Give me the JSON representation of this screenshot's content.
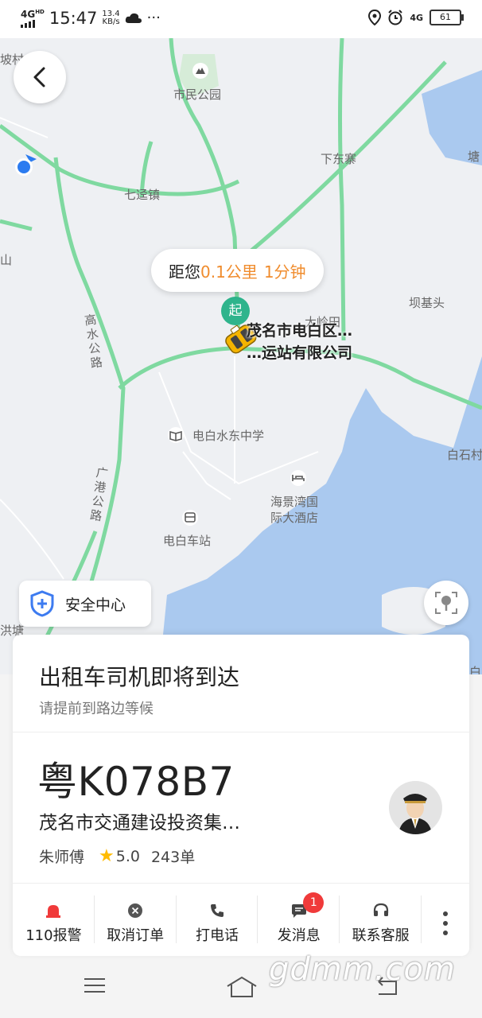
{
  "status_bar": {
    "network": "4G",
    "network_sup": "HD",
    "time": "15:47",
    "speed_value": "13.4",
    "speed_unit": "KB/s",
    "network_right": "4G",
    "battery": "61"
  },
  "map": {
    "labels": {
      "shimin_park": "市民公园",
      "qijing_town": "七迳镇",
      "xiadongzhai": "下东寨",
      "bajitou": "坝基头",
      "dalingtian": "大岭田",
      "gaoshui_road": "高水公路",
      "guanggang_road": "广港公路",
      "dianbai_school": "电白水东中学",
      "haijingwan_hotel_1": "海景湾国",
      "haijingwan_hotel_2": "际大酒店",
      "dianbai_station": "电白车站",
      "baishicun": "白石村",
      "left_edge_1": "坡村",
      "left_edge_2": "山",
      "left_edge_3": "洪塘",
      "right_edge_1": "塘",
      "right_edge_2": "白"
    },
    "bubble": {
      "prefix": "距您",
      "distance": "0.1公里",
      "eta": "1分钟"
    },
    "start_marker": "起",
    "pickup_place_line1": "茂名市电白区…",
    "pickup_place_line2": "…运站有限公司",
    "safety_center": "安全中心"
  },
  "card": {
    "title": "出租车司机即将到达",
    "subtitle": "请提前到路边等候",
    "plate": "粤K078B7",
    "company": "茂名市交通建设投资集…",
    "driver_name": "朱师傅",
    "rating": "5.0",
    "orders": "243单",
    "actions": [
      {
        "label": "110报警",
        "icon": "alarm-icon"
      },
      {
        "label": "取消订单",
        "icon": "cancel-icon"
      },
      {
        "label": "打电话",
        "icon": "phone-icon"
      },
      {
        "label": "发消息",
        "icon": "message-icon",
        "badge": "1"
      },
      {
        "label": "联系客服",
        "icon": "headset-icon"
      }
    ]
  },
  "watermark": "gdmm.com",
  "colors": {
    "accent_orange": "#f08c2d",
    "marker_green": "#2eb48c",
    "alarm_red": "#f03a3a",
    "water_blue": "#aac9ef",
    "road_green": "#7fd9a0"
  }
}
